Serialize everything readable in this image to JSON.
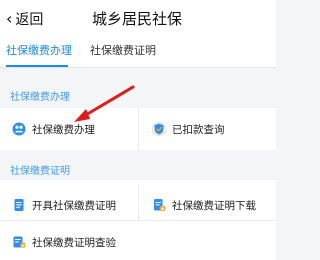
{
  "header": {
    "back_label": "返回",
    "title": "城乡居民社保"
  },
  "tabs": [
    {
      "label": "社保缴费办理",
      "active": true
    },
    {
      "label": "社保缴费证明",
      "active": false
    }
  ],
  "sections": [
    {
      "title": "社保缴费办理",
      "items": [
        {
          "label": "社保缴费办理",
          "icon": "people-wallet-icon"
        },
        {
          "label": "已扣款查询",
          "icon": "shield-check-icon"
        }
      ]
    },
    {
      "title": "社保缴费证明",
      "items": [
        {
          "label": "开具社保缴费证明",
          "icon": "document-icon"
        },
        {
          "label": "社保缴费证明下载",
          "icon": "document-download-icon"
        },
        {
          "label": "社保缴费证明查验",
          "icon": "document-verify-icon"
        }
      ]
    }
  ],
  "colors": {
    "accent": "#1a8cf0",
    "annotation_arrow": "#e01b1b"
  }
}
